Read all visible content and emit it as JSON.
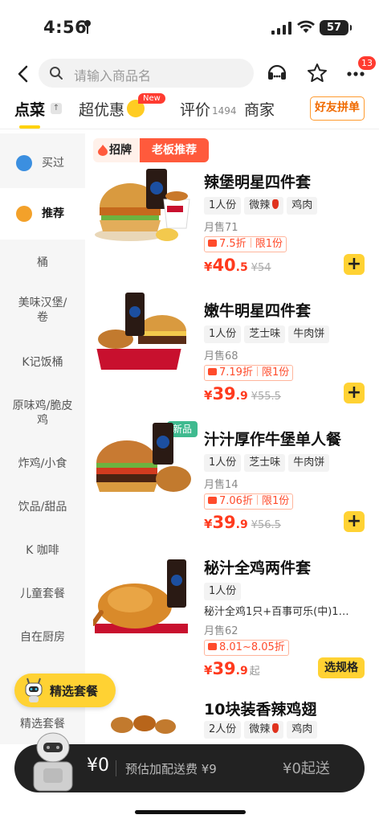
{
  "status": {
    "time": "4:56",
    "battery": "57"
  },
  "search": {
    "placeholder": "请输入商品名",
    "badge": "13"
  },
  "tabs": [
    {
      "label": "点菜"
    },
    {
      "label": "超优惠",
      "badge": "New"
    },
    {
      "label": "评价",
      "count": "1494"
    },
    {
      "label": "商家"
    }
  ],
  "friend_button": "好友拼单",
  "up_icon": "↑",
  "sidebar": {
    "items": [
      {
        "label": "买过"
      },
      {
        "label": "推荐"
      },
      {
        "label": "桶"
      },
      {
        "label": "美味汉堡/卷"
      },
      {
        "label": "K记饭桶"
      },
      {
        "label": "原味鸡/脆皮鸡"
      },
      {
        "label": "炸鸡/小食"
      },
      {
        "label": "饮品/甜品"
      },
      {
        "label": "K 咖啡"
      },
      {
        "label": "儿童套餐"
      },
      {
        "label": "自在厨房"
      },
      {
        "label": "精选套餐"
      }
    ]
  },
  "banner": {
    "left": "招牌",
    "right": "老板推荐"
  },
  "products": [
    {
      "name": "辣堡明星四件套",
      "tags": [
        "1人份",
        "微辣",
        "鸡肉"
      ],
      "sales": "月售71",
      "promo_discount": "7.5折",
      "promo_limit": "限1份",
      "price_int": "40",
      "price_dec": ".5",
      "orig": "¥54",
      "action": "+"
    },
    {
      "name": "嫩牛明星四件套",
      "tags": [
        "1人份",
        "芝士味",
        "牛肉饼"
      ],
      "sales": "月售68",
      "promo_discount": "7.19折",
      "promo_limit": "限1份",
      "price_int": "39",
      "price_dec": ".9",
      "orig": "¥55.5",
      "action": "+"
    },
    {
      "name": "汁汁厚作牛堡单人餐",
      "label": "新品",
      "tags": [
        "1人份",
        "芝士味",
        "牛肉饼"
      ],
      "sales": "月售14",
      "promo_discount": "7.06折",
      "promo_limit": "限1份",
      "price_int": "39",
      "price_dec": ".9",
      "orig": "¥56.5",
      "action": "+"
    },
    {
      "name": "秘汁全鸡两件套",
      "tags": [
        "1人份"
      ],
      "desc": "秘汁全鸡1只+百事可乐(中)1…",
      "sales": "月售62",
      "promo_discount": "8.01~8.05折",
      "price_int": "39",
      "price_dec": ".9",
      "price_suffix": "起",
      "action": "选规格"
    },
    {
      "name": "10块装香辣鸡翅",
      "tags": [
        "2人份",
        "微辣",
        "鸡肉"
      ]
    }
  ],
  "currency": "¥",
  "floating": {
    "label": "精选套餐"
  },
  "cart": {
    "amount": "¥0",
    "fee": "预估加配送费 ¥9",
    "start": "¥0起送"
  },
  "colors": {
    "accent": "#ffd233",
    "price": "#ff3a1e",
    "banner": "#ff5a3c",
    "new": "#3fba8f"
  }
}
